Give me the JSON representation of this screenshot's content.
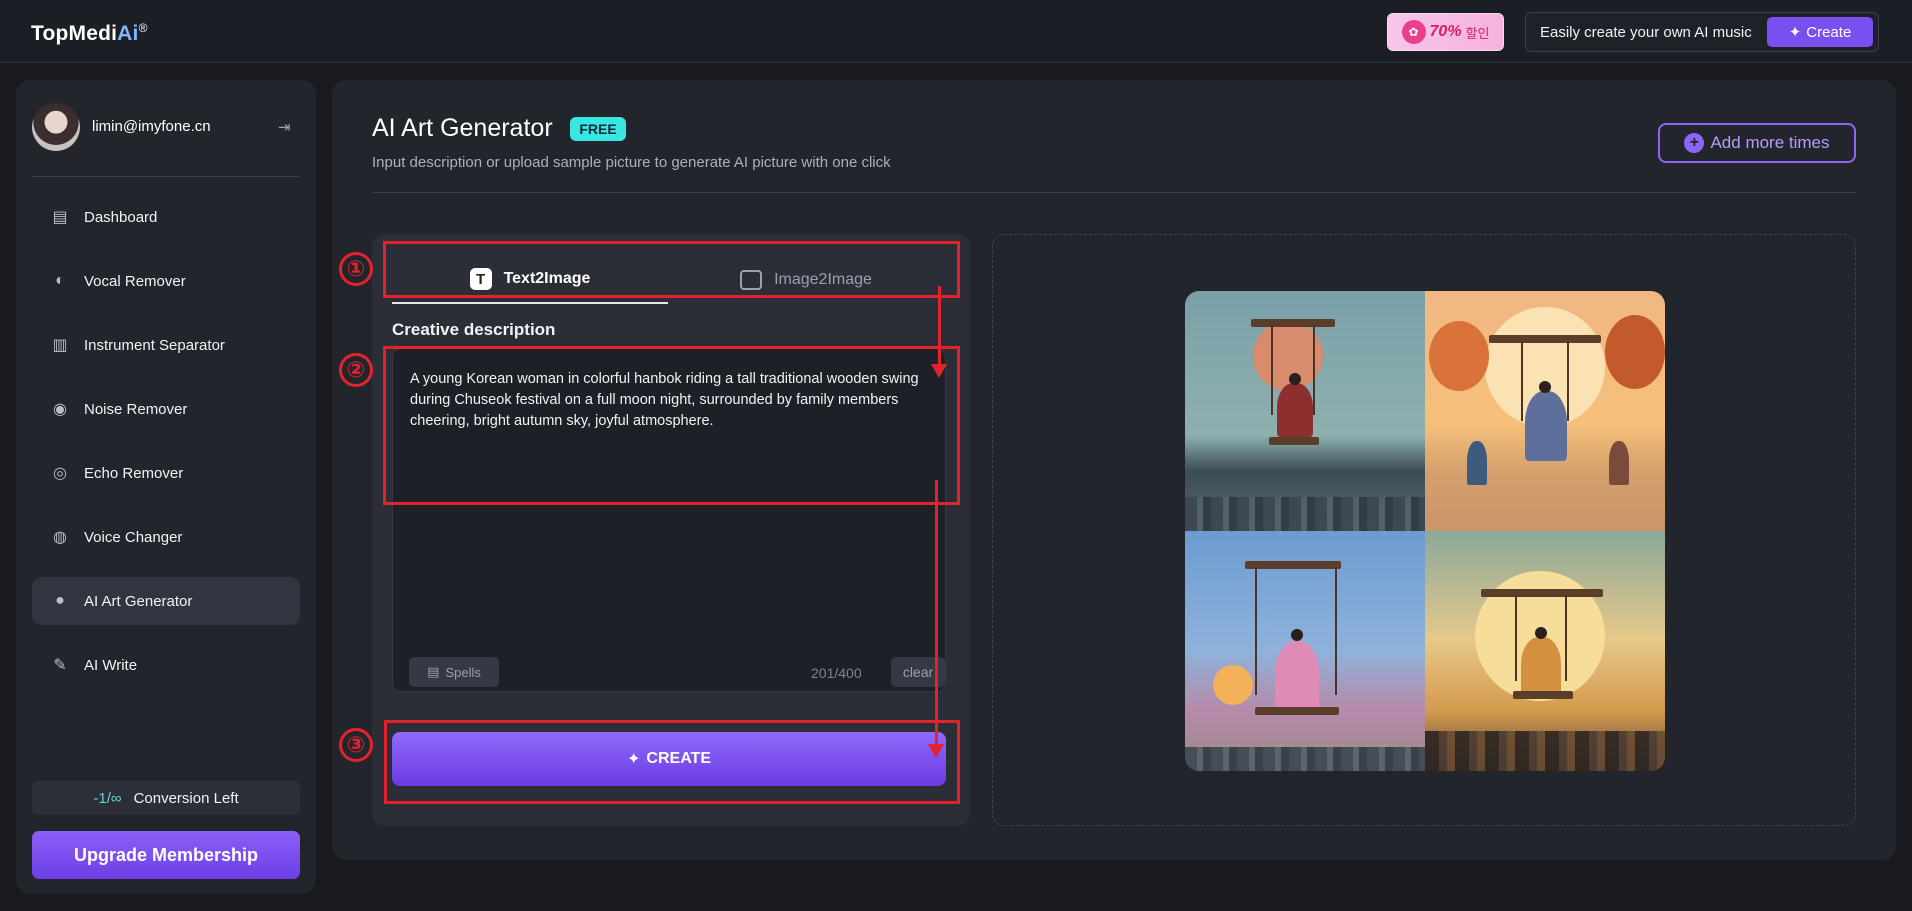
{
  "header": {
    "logo_prefix": "TopMedi",
    "logo_ai": "Ai",
    "logo_reg": "®",
    "promo_text": "70%",
    "promo_korean": "할인",
    "music_text": "Easily create your own AI music",
    "music_create_label": "Create"
  },
  "user": {
    "email": "limin@imyfone.cn"
  },
  "sidebar": {
    "items": [
      {
        "label": "Dashboard",
        "icon": "briefcase-icon"
      },
      {
        "label": "Vocal Remover",
        "icon": "head-voice-icon"
      },
      {
        "label": "Instrument Separator",
        "icon": "piano-keys-icon"
      },
      {
        "label": "Noise Remover",
        "icon": "noise-icon"
      },
      {
        "label": "Echo Remover",
        "icon": "echo-icon"
      },
      {
        "label": "Voice Changer",
        "icon": "voice-changer-icon"
      },
      {
        "label": "AI Art Generator",
        "icon": "palette-icon",
        "active": true
      },
      {
        "label": "AI Write",
        "icon": "write-icon"
      }
    ],
    "conversion_count": "-1/∞",
    "conversion_label": "Conversion Left",
    "upgrade_label": "Upgrade Membership"
  },
  "main": {
    "title": "AI Art Generator",
    "badge": "FREE",
    "subtitle": "Input description or upload sample picture to generate AI picture with one click",
    "add_more_label": "Add more times",
    "tabs": [
      {
        "label": "Text2Image",
        "active": true
      },
      {
        "label": "Image2Image",
        "active": false
      }
    ],
    "creative_label": "Creative description",
    "description": "A young Korean woman in colorful hanbok riding a tall traditional wooden swing during Chuseok festival on a full moon night, surrounded by family members cheering, bright autumn sky, joyful atmosphere.",
    "spells_label": "Spells",
    "counter": "201/400",
    "clear_label": "clear",
    "create_label": "CREATE"
  },
  "annotations": [
    "①",
    "②",
    "③"
  ],
  "colors": {
    "accent": "#7a4ff0",
    "annotation": "#e3232b",
    "badge": "#38e8e0"
  }
}
